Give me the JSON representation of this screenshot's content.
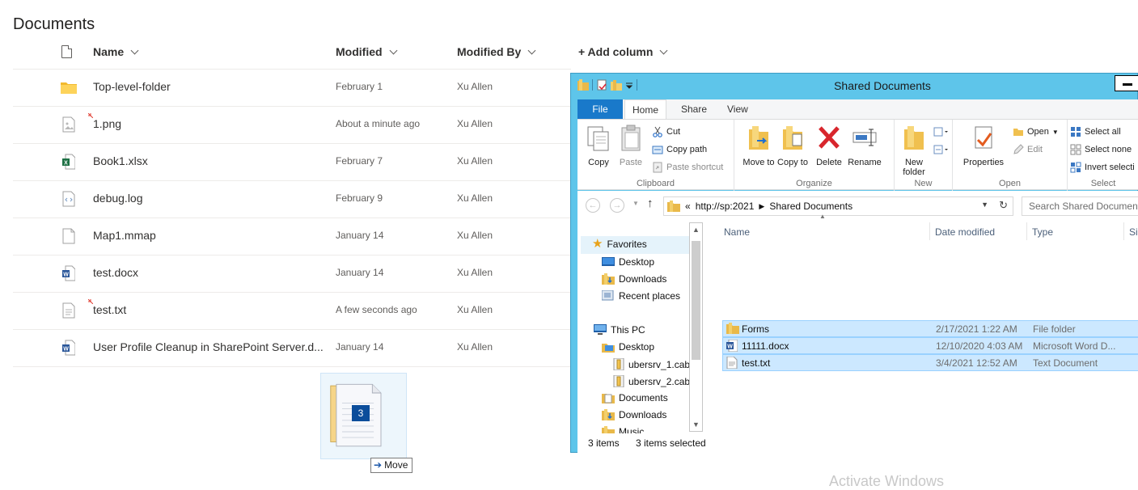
{
  "library": {
    "title": "Documents",
    "columns": {
      "name": "Name",
      "modified": "Modified",
      "modified_by": "Modified By",
      "add_column": "+ Add column"
    },
    "rows": [
      {
        "name": "Top-level-folder",
        "modified": "February 1",
        "by": "Xu Allen",
        "icon": "folder-icon"
      },
      {
        "name": "1.png",
        "modified": "About a minute ago",
        "by": "Xu Allen",
        "icon": "image-file-icon"
      },
      {
        "name": "Book1.xlsx",
        "modified": "February 7",
        "by": "Xu Allen",
        "icon": "excel-file-icon"
      },
      {
        "name": "debug.log",
        "modified": "February 9",
        "by": "Xu Allen",
        "icon": "code-file-icon"
      },
      {
        "name": "Map1.mmap",
        "modified": "January 14",
        "by": "Xu Allen",
        "icon": "generic-file-icon"
      },
      {
        "name": "test.docx",
        "modified": "January 14",
        "by": "Xu Allen",
        "icon": "word-file-icon"
      },
      {
        "name": "test.txt",
        "modified": "A few seconds ago",
        "by": "Xu Allen",
        "icon": "text-file-icon"
      },
      {
        "name": "User Profile Cleanup in SharePoint Server.d...",
        "modified": "January 14",
        "by": "Xu Allen",
        "icon": "word-file-icon"
      }
    ]
  },
  "drag": {
    "count": "3",
    "tooltip": "Move"
  },
  "watermark": "Activate Windows",
  "explorer": {
    "title": "Shared Documents",
    "tabs": {
      "file": "File",
      "home": "Home",
      "share": "Share",
      "view": "View"
    },
    "ribbon": {
      "clipboard": {
        "label": "Clipboard",
        "copy": "Copy",
        "paste": "Paste",
        "cut": "Cut",
        "copy_path": "Copy path",
        "paste_shortcut": "Paste shortcut"
      },
      "organize": {
        "label": "Organize",
        "move_to": "Move to",
        "copy_to": "Copy to",
        "delete": "Delete",
        "rename": "Rename"
      },
      "new": {
        "label": "New",
        "new_folder": "New folder"
      },
      "open": {
        "label": "Open",
        "properties": "Properties",
        "open": "Open",
        "edit": "Edit"
      },
      "select": {
        "label": "Select",
        "select_all": "Select all",
        "select_none": "Select none",
        "invert": "Invert selecti"
      }
    },
    "address": {
      "prefix": "«",
      "root": "http://sp:2021",
      "folder": "Shared Documents"
    },
    "search_placeholder": "Search Shared Documents",
    "nav": {
      "favorites": "Favorites",
      "fav_items": [
        "Desktop",
        "Downloads",
        "Recent places"
      ],
      "this_pc": "This PC",
      "pc_items": [
        "Desktop",
        "ubersrv_1.cab",
        "ubersrv_2.cab",
        "Documents",
        "Downloads",
        "Music"
      ]
    },
    "columns": {
      "name": "Name",
      "date": "Date modified",
      "type": "Type",
      "size": "Size"
    },
    "files": [
      {
        "name": "Forms",
        "date": "2/17/2021 1:22 AM",
        "type": "File folder"
      },
      {
        "name": "11111.docx",
        "date": "12/10/2020 4:03 AM",
        "type": "Microsoft Word D..."
      },
      {
        "name": "test.txt",
        "date": "3/4/2021 12:52 AM",
        "type": "Text Document"
      }
    ],
    "status": {
      "items": "3 items",
      "selected": "3 items selected"
    }
  }
}
